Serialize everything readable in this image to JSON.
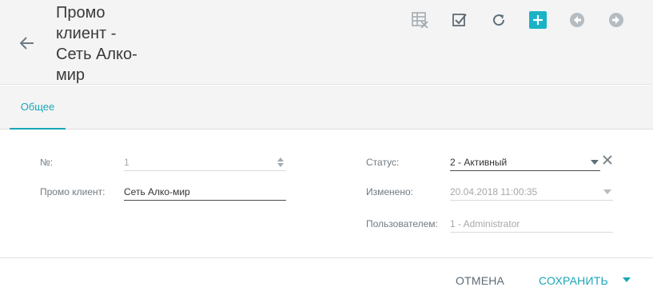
{
  "header": {
    "title": "Промо клиент - Сеть Алко-мир",
    "toolbar": {
      "icons": [
        "table-clear-icon",
        "checkbox-icon",
        "refresh-icon",
        "add-icon",
        "arrow-left-circle-icon",
        "arrow-right-circle-icon"
      ]
    }
  },
  "tabs": [
    {
      "label": "Общее"
    }
  ],
  "form": {
    "number_label": "№:",
    "number_value": "1",
    "promo_client_label": "Промо клиент:",
    "promo_client_value": "Сеть Алко-мир",
    "status_label": "Статус:",
    "status_value": "2 - Активный",
    "changed_label": "Изменено:",
    "changed_value": "20.04.2018 11:00:35",
    "user_label": "Пользователем:",
    "user_value": "1 - Administrator"
  },
  "footer": {
    "cancel_label": "ОТМЕНА",
    "save_label": "СОХРАНИТЬ"
  },
  "colors": {
    "accent": "#1aa6b7",
    "add_button_bg": "#1ab3c6",
    "header_bg": "#f4f4f4"
  }
}
